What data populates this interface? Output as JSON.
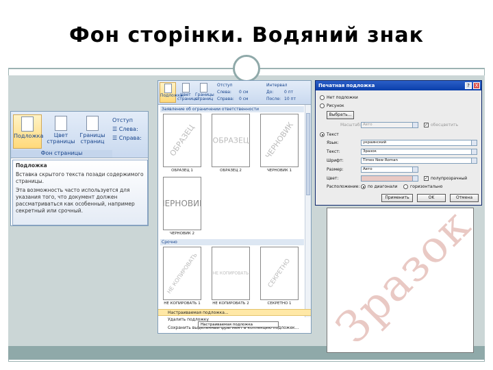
{
  "slide": {
    "title": "Фон сторінки. Водяний знак"
  },
  "ribbon_panel": {
    "buttons": [
      {
        "label": "Подложка",
        "icon": "watermark-icon"
      },
      {
        "label": "Цвет страницы",
        "icon": "page-color-icon"
      },
      {
        "label": "Границы страниц",
        "icon": "page-borders-icon"
      }
    ],
    "group_label": "Фон страницы",
    "indent_header": "Отступ",
    "indent_left": "Слева:",
    "indent_right": "Справа:",
    "tooltip": {
      "title": "Подложка",
      "line1": "Вставка скрытого текста позади содержимого страницы.",
      "line2": "Эта возможность часто используется для указания того, что документ должен рассматриваться как особенный, например секретный или срочный."
    }
  },
  "gallery_panel": {
    "buttons": [
      {
        "label": "Подложка"
      },
      {
        "label": "Цвет страницы"
      },
      {
        "label": "Границы страниц"
      }
    ],
    "indent_header": "Отступ",
    "spacing_header": "Интервал",
    "left_label": "Слева:",
    "left_value": "0 см",
    "right_label": "Справа:",
    "right_value": "0 см",
    "before_label": "До:",
    "before_value": "0 пт",
    "after_label": "После:",
    "after_value": "10 пт",
    "section1_header": "Заявление об ограничении ответственности",
    "section2_header": "Срочно",
    "thumbs": [
      {
        "word": "ОБРАЗЕЦ",
        "caption": "ОБРАЗЕЦ 1",
        "style": "diagonal"
      },
      {
        "word": "ОБРАЗЕЦ",
        "caption": "ОБРАЗЕЦ 2",
        "style": "horizontal"
      },
      {
        "word": "ЧЕРНОВИК",
        "caption": "ЧЕРНОВИК 1",
        "style": "diagonal"
      },
      {
        "word": "ЧЕРНОВИК",
        "caption": "ЧЕРНОВИК 2",
        "style": "horizontal-outline"
      },
      {
        "word": "НЕ КОПИРОВАТЬ",
        "caption": "НЕ КОПИРОВАТЬ 1",
        "style": "diagonal"
      },
      {
        "word": "НЕ КОПИРОВАТЬ",
        "caption": "НЕ КОПИРОВАТЬ 2",
        "style": "horizontal"
      },
      {
        "word": "СЕКРЕТНО",
        "caption": "СЕКРЕТНО 1",
        "style": "diagonal"
      }
    ],
    "menu": [
      {
        "label": "Настраиваемая подложка..."
      },
      {
        "label": "Удалить подложку"
      },
      {
        "label": "Сохранить выделенный фрагмент в коллекцию подложек..."
      }
    ],
    "menu_tooltip": "Настраиваемая подложка"
  },
  "dialog": {
    "title": "Печатная подложка",
    "help_button": "?",
    "close_button": "X",
    "opt_none": "Нет подложки",
    "opt_picture": "Рисунок",
    "select_button": "Выбрать...",
    "scale_label": "Масштаб:",
    "scale_value": "Авто",
    "washout_label": "обесцветить",
    "opt_text": "Текст",
    "language_label": "Язык:",
    "language_value": "украинский",
    "text_label": "Текст:",
    "text_value": "Зразок",
    "font_label": "Шрифт:",
    "font_value": "Times New Roman",
    "size_label": "Размер:",
    "size_value": "Авто",
    "color_label": "Цвет:",
    "semitransparent_label": "полупрозрачный",
    "layout_label": "Расположение:",
    "layout_diagonal": "по диагонали",
    "layout_horizontal": "горизонтально",
    "apply_button": "Применить",
    "ok_button": "OK",
    "cancel_button": "Отмена"
  },
  "preview": {
    "watermark_text": "Зразок",
    "watermark_color": "#e9c9c4"
  }
}
